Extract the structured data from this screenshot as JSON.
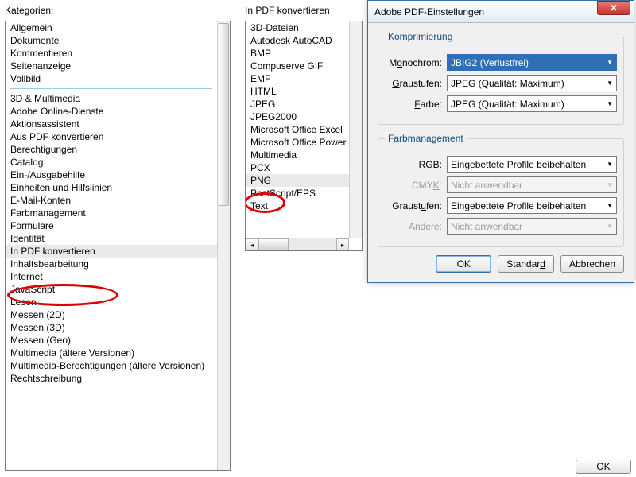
{
  "left": {
    "label": "Kategorien:",
    "group1": [
      "Allgemein",
      "Dokumente",
      "Kommentieren",
      "Seitenanzeige",
      "Vollbild"
    ],
    "group2": [
      "3D & Multimedia",
      "Adobe Online-Dienste",
      "Aktionsassistent",
      "Aus PDF konvertieren",
      "Berechtigungen",
      "Catalog",
      "Ein-/Ausgabehilfe",
      "Einheiten und Hilfslinien",
      "E-Mail-Konten",
      "Farbmanagement",
      "Formulare",
      "Identität",
      "In PDF konvertieren",
      "Inhaltsbearbeitung",
      "Internet",
      "JavaScript",
      "Lesen",
      "Messen (2D)",
      "Messen (3D)",
      "Messen (Geo)",
      "Multimedia (ältere Versionen)",
      "Multimedia-Berechtigungen (ältere Versionen)",
      "Rechtschreibung"
    ],
    "selected": "In PDF konvertieren"
  },
  "middle": {
    "label": "In PDF konvertieren",
    "items": [
      "3D-Dateien",
      "Autodesk AutoCAD",
      "BMP",
      "Compuserve GIF",
      "EMF",
      "HTML",
      "JPEG",
      "JPEG2000",
      "Microsoft Office Excel",
      "Microsoft Office Power",
      "Multimedia",
      "PCX",
      "PNG",
      "PostScript/EPS",
      "Text"
    ],
    "selected": "PNG"
  },
  "dialog": {
    "title": "Adobe PDF-Einstellungen",
    "close": "✕",
    "compression": {
      "legend": "Komprimierung",
      "mono_pre": "M",
      "mono_u": "o",
      "mono_post": "nochrom:",
      "mono_value": "JBIG2 (Verlustfrei)",
      "gray_pre": "",
      "gray_u": "G",
      "gray_post": "raustufen:",
      "gray_value": "JPEG (Qualität: Maximum)",
      "color_pre": "",
      "color_u": "F",
      "color_post": "arbe:",
      "color_value": "JPEG (Qualität: Maximum)"
    },
    "colormgmt": {
      "legend": "Farbmanagement",
      "rgb_pre": "RG",
      "rgb_u": "B",
      "rgb_post": ":",
      "rgb_value": "Eingebettete Profile beibehalten",
      "cmyk_pre": "CMY",
      "cmyk_u": "K",
      "cmyk_post": ":",
      "cmyk_value": "Nicht anwendbar",
      "gray2_pre": "Graust",
      "gray2_u": "u",
      "gray2_post": "fen:",
      "gray2_value": "Eingebettete Profile beibehalten",
      "other_pre": "A",
      "other_u": "n",
      "other_post": "dere:",
      "other_value": "Nicht anwendbar"
    },
    "buttons": {
      "ok": "OK",
      "std_pre": "Standar",
      "std_u": "d",
      "cancel": "Abbrechen"
    }
  },
  "bottom_ok": "OK"
}
